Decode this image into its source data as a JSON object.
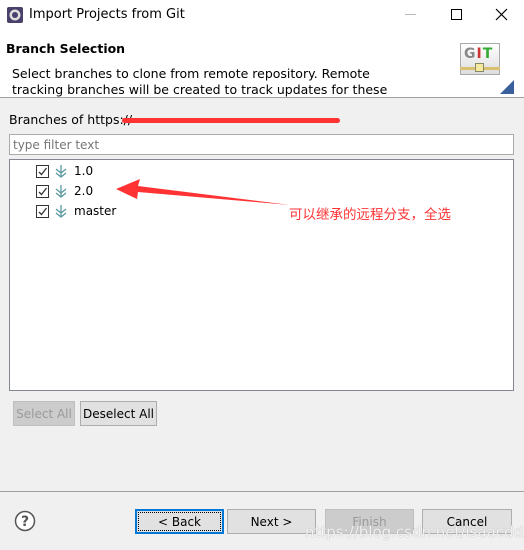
{
  "window": {
    "title": "Import Projects from Git",
    "icon": "eclipse-gear-icon"
  },
  "header": {
    "title": "Branch Selection",
    "description": "Select branches to clone from remote repository. Remote tracking branches will be created to track updates for these branches in the",
    "logo": "GIT"
  },
  "branches_label": "Branches of https://",
  "filter": {
    "placeholder": "type filter text",
    "value": ""
  },
  "branches": [
    {
      "name": "1.0",
      "checked": true
    },
    {
      "name": "2.0",
      "checked": true
    },
    {
      "name": "master",
      "checked": true
    }
  ],
  "annotation": {
    "text": "可以继承的远程分支，全选",
    "color": "#ff3333"
  },
  "buttons": {
    "select_all": "Select All",
    "deselect_all": "Deselect All",
    "back": "< Back",
    "next": "Next >",
    "finish": "Finish",
    "cancel": "Cancel"
  },
  "watermark": "https://blog.csdn.net/isaacddx"
}
